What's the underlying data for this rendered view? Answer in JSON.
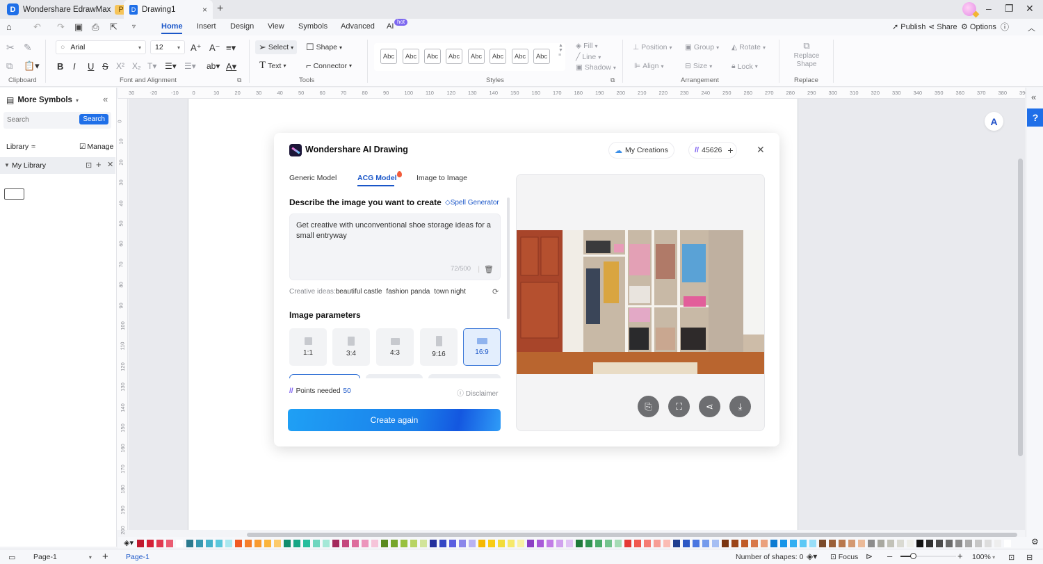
{
  "titlebar": {
    "app_name": "Wondershare EdrawMax",
    "badge": "Pro",
    "doc_tab": "Drawing1",
    "close_tab": "×",
    "new_tab": "+",
    "minimize": "–",
    "restore": "❐",
    "close": "✕"
  },
  "menubar": {
    "items": [
      "Home",
      "Insert",
      "Design",
      "View",
      "Symbols",
      "Advanced",
      "AI"
    ],
    "ai_badge": "hot",
    "right": {
      "publish": "Publish",
      "share": "Share",
      "options": "Options"
    }
  },
  "ribbon": {
    "clipboard_label": "Clipboard",
    "font_label": "Font and Alignment",
    "font_name": "Arial",
    "font_size": "12",
    "tools_label": "Tools",
    "select": "Select",
    "shape": "Shape",
    "text": "Text",
    "connector": "Connector",
    "styles_label": "Styles",
    "style_sample": "Abc",
    "fill": "Fill",
    "line": "Line",
    "shadow": "Shadow",
    "arrangement_label": "Arrangement",
    "position": "Position",
    "group": "Group",
    "rotate": "Rotate",
    "align": "Align",
    "size": "Size",
    "lock": "Lock",
    "replace_shape": "Replace Shape",
    "replace_label": "Replace"
  },
  "leftpanel": {
    "title": "More Symbols",
    "search_placeholder": "Search",
    "search_button": "Search",
    "library": "Library",
    "manage": "Manage",
    "my_library": "My Library"
  },
  "rulers": {
    "horizontal": [
      "30",
      "-20",
      "-10",
      "0",
      "10",
      "20",
      "30",
      "40",
      "50",
      "60",
      "70",
      "80",
      "90",
      "100",
      "110",
      "120",
      "130",
      "140",
      "150",
      "160",
      "170",
      "180",
      "190",
      "200",
      "210",
      "220",
      "230",
      "240",
      "250",
      "260",
      "270",
      "280",
      "290",
      "300",
      "310",
      "320",
      "330",
      "340",
      "350",
      "360",
      "370",
      "380",
      "390",
      "40"
    ],
    "vertical": [
      "0",
      "10",
      "20",
      "30",
      "40",
      "50",
      "60",
      "70",
      "80",
      "90",
      "100",
      "110",
      "120",
      "130",
      "140",
      "150",
      "160",
      "170",
      "180",
      "190",
      "200"
    ]
  },
  "dialog": {
    "title": "Wondershare AI Drawing",
    "my_creations": "My Creations",
    "points_balance": "45626",
    "tabs": [
      "Generic Model",
      "ACG Model",
      "Image to Image"
    ],
    "active_tab": "ACG Model",
    "describe_label": "Describe the image you want to create",
    "spell_generator": "Spell Generator",
    "prompt": "Get creative with unconventional shoe storage ideas for a small entryway",
    "char_count": "72/500",
    "creative_ideas_label": "Creative ideas:",
    "creative_ideas": [
      "beautiful castle",
      "fashion panda",
      "town night"
    ],
    "image_params_label": "Image parameters",
    "ratios": [
      "1:1",
      "3:4",
      "4:3",
      "9:16",
      "16:9"
    ],
    "selected_ratio": "16:9",
    "points_needed_label": "Points needed",
    "points_needed": "50",
    "disclaimer": "Disclaimer",
    "create_button": "Create again",
    "image_alt": "Entryway closet with open shelving holding shoes, boots and hanging coats"
  },
  "palette": {
    "colors": [
      "#c0182d",
      "#d41f35",
      "#e0394f",
      "#ea5d72",
      "#ffffff",
      "#2b7a8e",
      "#3798b0",
      "#45b1c9",
      "#5bc7db",
      "#a9e7ef",
      "#f05a24",
      "#f57d2a",
      "#f89a30",
      "#fbb43c",
      "#fcca6a",
      "#0f8c6c",
      "#16a685",
      "#25bd9c",
      "#6fd6bf",
      "#a5e8d7",
      "#a3285b",
      "#c4477d",
      "#dd6c9c",
      "#ec95bc",
      "#f6c4d9",
      "#5a8a1f",
      "#76a62b",
      "#98c13e",
      "#b8d464",
      "#d2e49a",
      "#232f9c",
      "#3346c4",
      "#5a5ee0",
      "#8a86ea",
      "#b9b3f2",
      "#f5b800",
      "#f8cc14",
      "#f2dc3a",
      "#f6e96b",
      "#f9f2a4",
      "#8c3fc4",
      "#a85ad8",
      "#c27de6",
      "#d1a2ee",
      "#e0c3f4",
      "#1f7a3a",
      "#2f9450",
      "#4aab6a",
      "#74c38e",
      "#a5dbb5",
      "#e53935",
      "#f0584f",
      "#f57c74",
      "#f79d95",
      "#fbbcb4",
      "#1e3d8f",
      "#2c58c4",
      "#4a76e0",
      "#759bec",
      "#a5bef3",
      "#7a3410",
      "#9b4418",
      "#c05a26",
      "#d8784a",
      "#eaa07d",
      "#0b7ad1",
      "#1594e8",
      "#31aef2",
      "#5ec8f5",
      "#98def8",
      "#7a4a2a",
      "#9a5f38",
      "#b8784d",
      "#d39870",
      "#ebba98",
      "#8c8c8c",
      "#a8a8a0",
      "#c2c2b8",
      "#dadad2",
      "#eeeee8",
      "#111111",
      "#2e2e2e",
      "#4a4a4a",
      "#6a6a6a",
      "#8a8a8a",
      "#aaaaaa",
      "#c6c6c6",
      "#dddddd",
      "#eeeeee",
      "#ffffff"
    ]
  },
  "statusbar": {
    "page_dropdown": "Page-1",
    "active_page": "Page-1",
    "shapes": "Number of shapes: 0",
    "focus": "Focus",
    "zoom": "100%",
    "zoom_fraction": 0.22
  }
}
